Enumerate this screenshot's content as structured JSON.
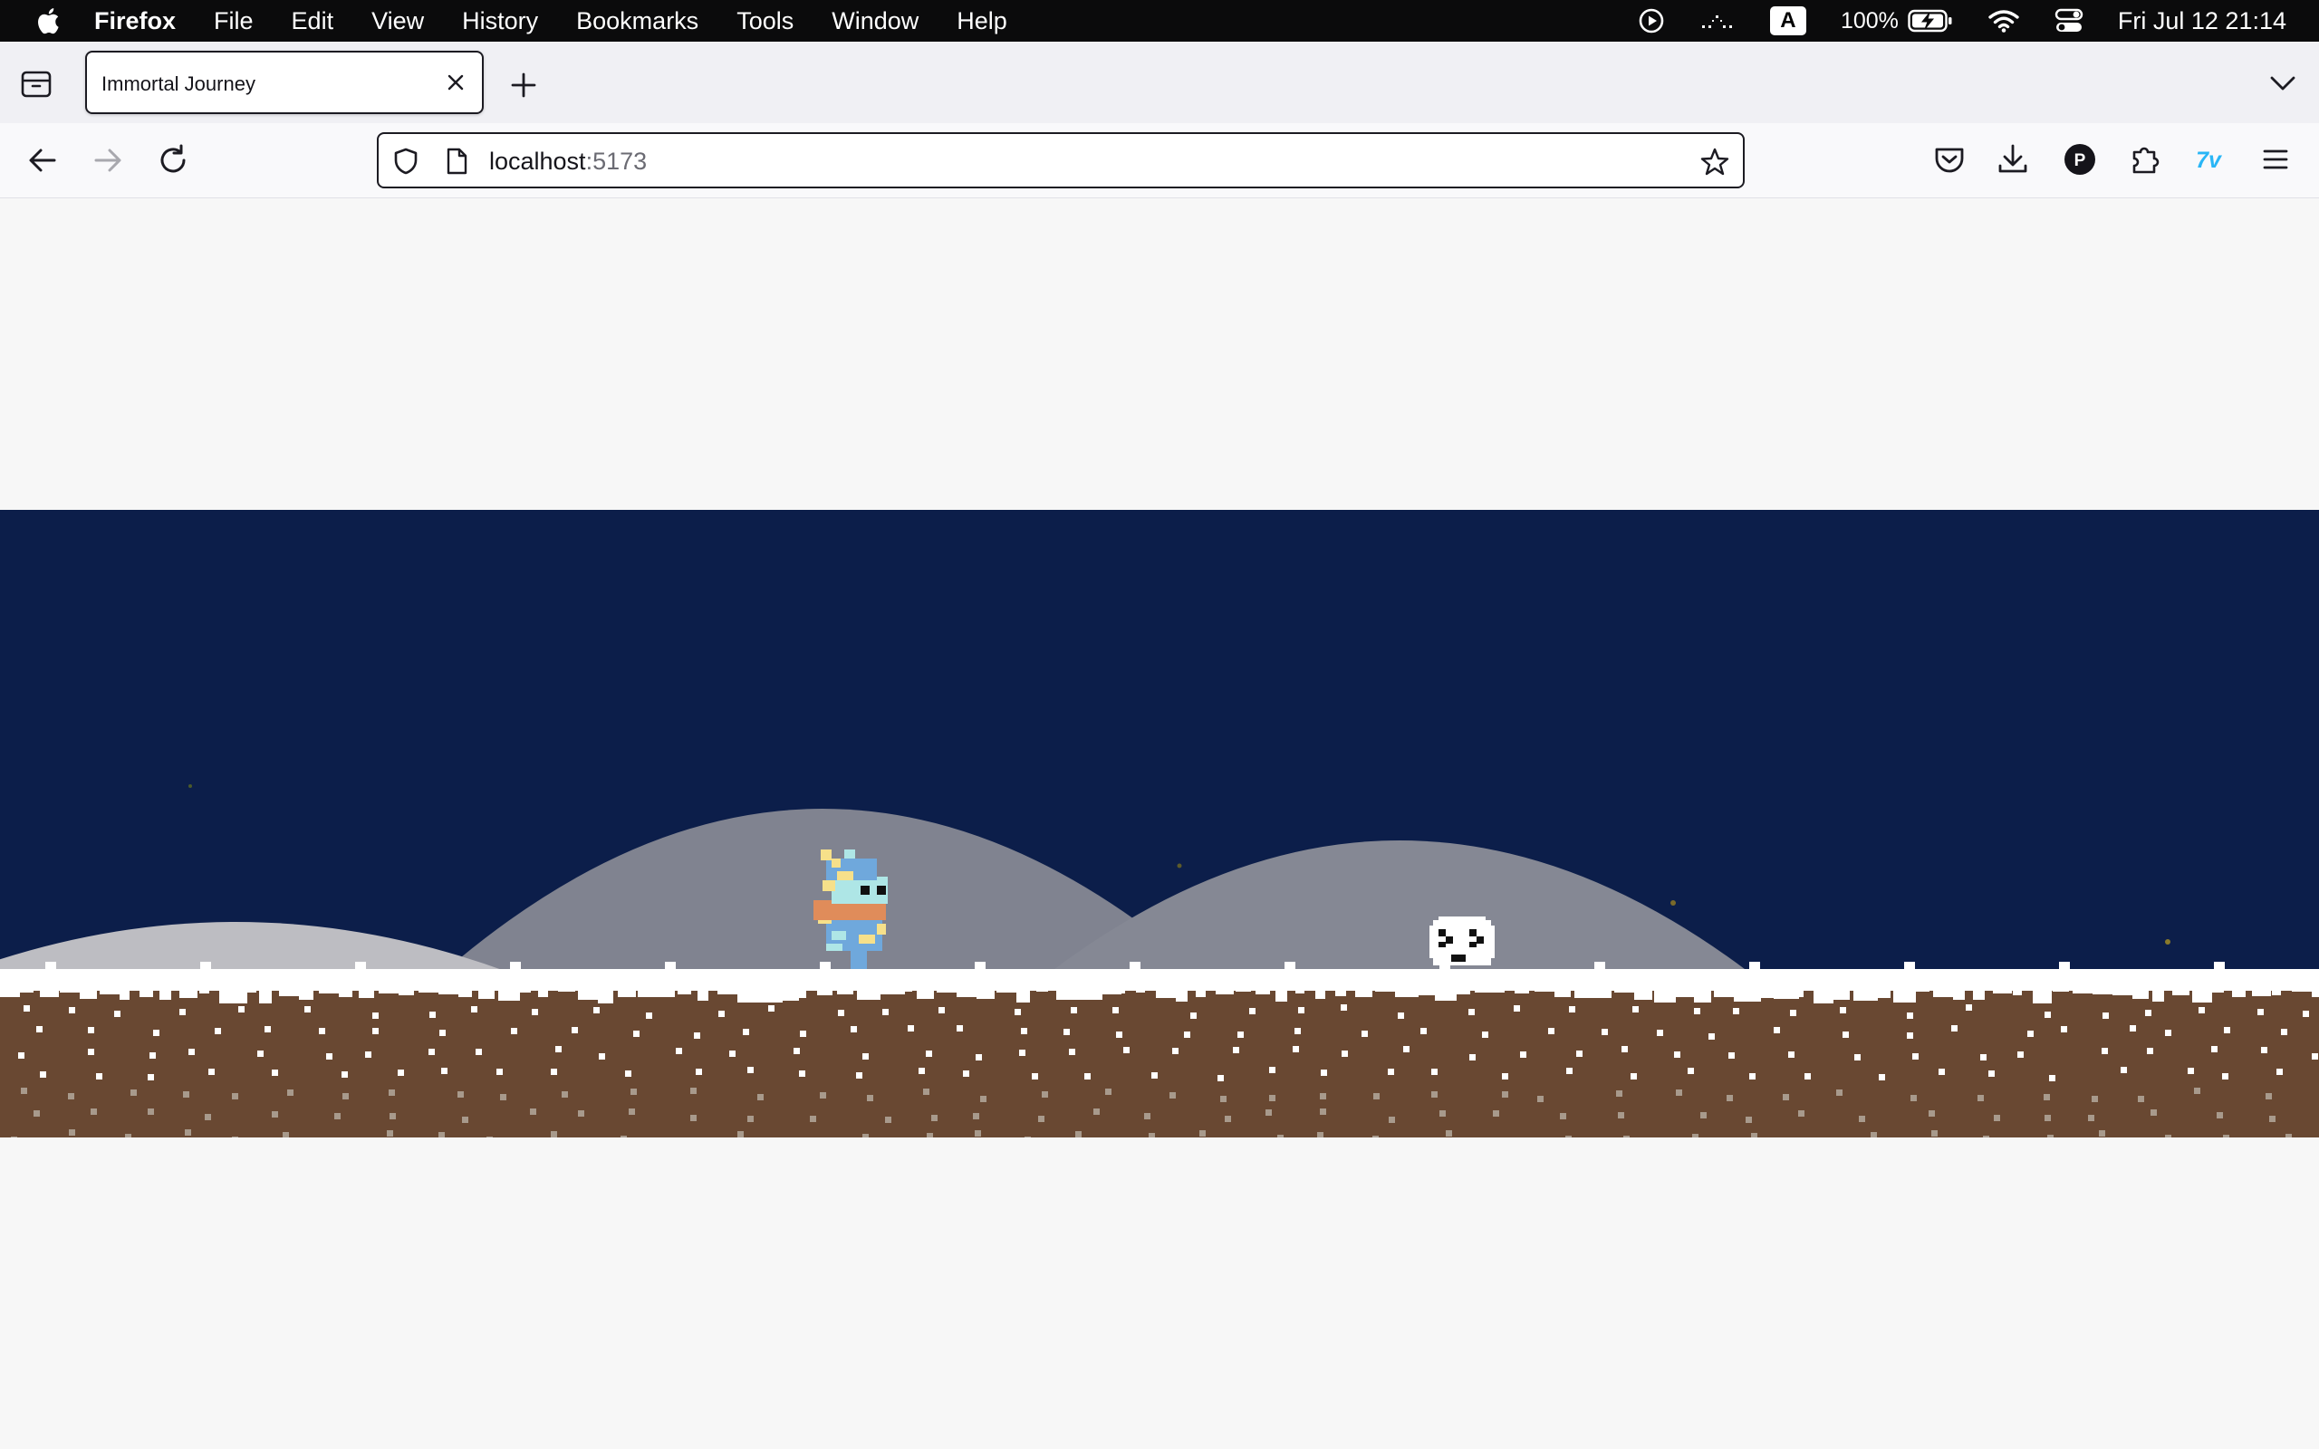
{
  "menubar": {
    "app_name": "Firefox",
    "menus": [
      "File",
      "Edit",
      "View",
      "History",
      "Bookmarks",
      "Tools",
      "Window",
      "Help"
    ],
    "input_source": "A",
    "battery_percent": "100%",
    "clock": "Fri Jul 12  21:14",
    "icons": [
      "apple-logo",
      "play-circle-icon",
      "display-icon",
      "input-source-icon",
      "battery-icon",
      "wifi-icon",
      "control-center-icon"
    ]
  },
  "browser": {
    "tab": {
      "title": "Immortal Journey"
    },
    "url_host": "localhost",
    "url_port": ":5173",
    "toolbar_icons": [
      "pocket-icon",
      "downloads-icon",
      "profile-icon",
      "extensions-icon",
      "extension-7tv-icon",
      "menu-icon"
    ],
    "profile_initial": "P",
    "extension_label": "7v"
  },
  "game": {
    "title": "Immortal Journey",
    "colors": {
      "sky": "#0c1e4a",
      "hill_far": "#808390",
      "hill_near": "#bdbdc2",
      "snow": "#ffffff",
      "dirt": "#694832",
      "player_hat": "#6fa8dc",
      "player_scarf": "#e08c5a"
    },
    "sprites": [
      "player-character",
      "snow-creature-enemy"
    ]
  }
}
